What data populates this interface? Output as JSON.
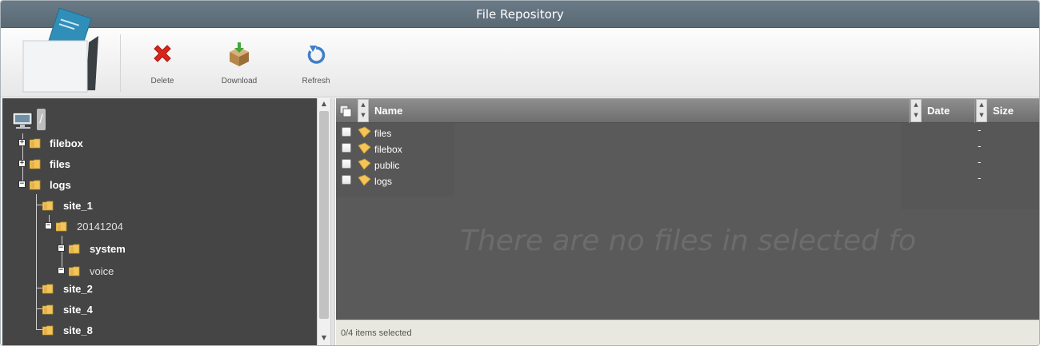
{
  "window": {
    "title": "File Repository"
  },
  "toolbar": {
    "buttons": [
      {
        "id": "delete",
        "label": "Delete",
        "icon": "delete-x-icon",
        "color": "#d8261a"
      },
      {
        "id": "download",
        "label": "Download",
        "icon": "download-box-icon",
        "color": "#b5874a"
      },
      {
        "id": "refresh",
        "label": "Refresh",
        "icon": "refresh-icon",
        "color": "#3f7fc7"
      }
    ]
  },
  "tree": {
    "root_label": "/",
    "nodes": [
      {
        "label": "filebox",
        "expander": "+"
      },
      {
        "label": "files",
        "expander": "+"
      },
      {
        "label": "logs",
        "expander": "−"
      },
      {
        "label": "site_1"
      },
      {
        "label": "20141204",
        "expander": "−"
      },
      {
        "label": "system",
        "expander": "−"
      },
      {
        "label": "voice",
        "expander": "−"
      },
      {
        "label": "site_2"
      },
      {
        "label": "site_4"
      },
      {
        "label": "site_8"
      }
    ]
  },
  "grid": {
    "columns": {
      "name": "Name",
      "date": "Date",
      "size": "Size"
    },
    "rows": [
      {
        "name": "files",
        "size": "-"
      },
      {
        "name": "filebox",
        "size": "-"
      },
      {
        "name": "public",
        "size": "-"
      },
      {
        "name": "logs",
        "size": "-"
      }
    ],
    "empty_message": "There are no files in selected folder"
  },
  "status": {
    "text": "0/4 items selected"
  },
  "colors": {
    "titlebar": "#5f6f7a",
    "tree_bg": "#454545",
    "grid_bg": "#5a5a5a",
    "folder": "#f2c45a"
  }
}
